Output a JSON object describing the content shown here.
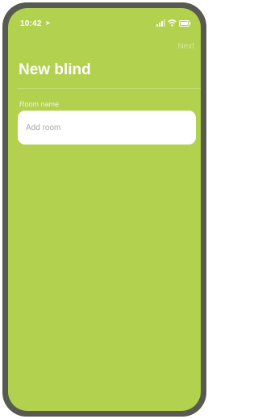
{
  "status_bar": {
    "time": "10:42",
    "location_icon": "location-arrow-icon",
    "icons": [
      "signal-icon",
      "wifi-icon",
      "battery-icon"
    ]
  },
  "header": {
    "next_label": "Next",
    "title": "New blind"
  },
  "form": {
    "room_label": "Room name",
    "room_value": "",
    "room_placeholder": "Add room"
  },
  "colors": {
    "background": "#b2d14f",
    "frame": "#585a4f",
    "text": "#ffffff"
  }
}
